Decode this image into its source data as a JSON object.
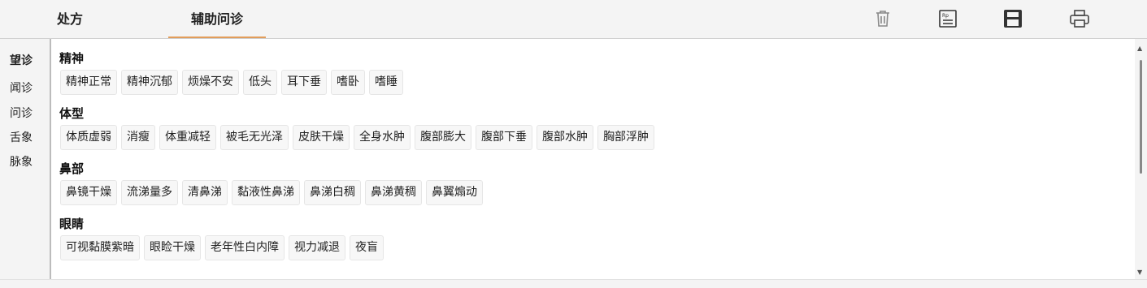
{
  "tabs": [
    {
      "label": "处方"
    },
    {
      "label": "辅助问诊"
    }
  ],
  "toolbar": {
    "icons": [
      "trash-icon",
      "prescription-icon",
      "save-icon",
      "print-icon"
    ]
  },
  "left_nav": {
    "items": [
      {
        "label": "望诊"
      },
      {
        "label": "闻诊"
      },
      {
        "label": "问诊"
      },
      {
        "label": "舌象"
      },
      {
        "label": "脉象"
      }
    ]
  },
  "sections": [
    {
      "title": "精神",
      "chips": [
        "精神正常",
        "精神沉郁",
        "烦燥不安",
        "低头",
        "耳下垂",
        "嗜卧",
        "嗜睡"
      ]
    },
    {
      "title": "体型",
      "chips": [
        "体质虚弱",
        "消瘦",
        "体重减轻",
        "被毛无光泽",
        "皮肤干燥",
        "全身水肿",
        "腹部膨大",
        "腹部下垂",
        "腹部水肿",
        "胸部浮肿"
      ]
    },
    {
      "title": "鼻部",
      "chips": [
        "鼻镜干燥",
        "流涕量多",
        "清鼻涕",
        "黏液性鼻涕",
        "鼻涕白稠",
        "鼻涕黄稠",
        "鼻翼煽动"
      ]
    },
    {
      "title": "眼睛",
      "chips": [
        "可视黏膜紫暗",
        "眼睑干燥",
        "老年性白内障",
        "视力减退",
        "夜盲"
      ]
    }
  ],
  "colors": {
    "active_tab_underline": "#e29d5a",
    "icon": "#555555"
  }
}
